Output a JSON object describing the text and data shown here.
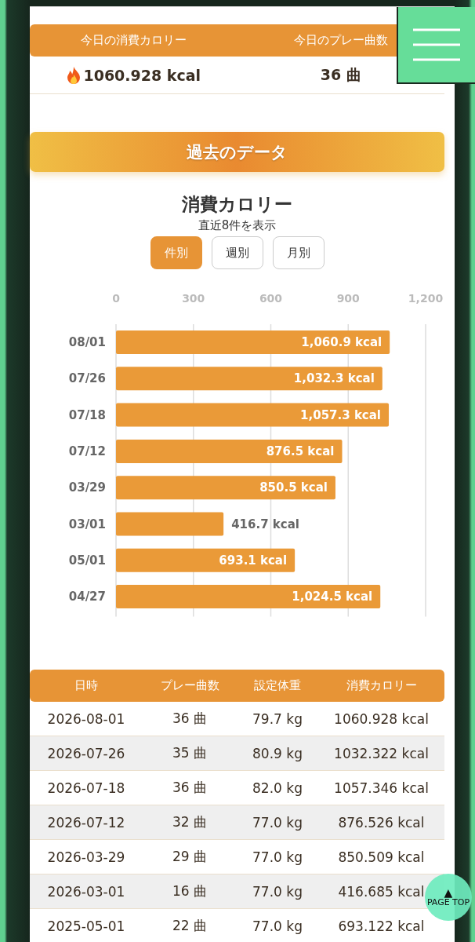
{
  "today_stats": {
    "headers": [
      "今日の消費カロリー",
      "今日のプレー曲数"
    ],
    "calories": "1060.928 kcal",
    "songs": "36 曲"
  },
  "section_title": "過去のデータ",
  "chart_section": {
    "subtitle": "直近8件を表示",
    "tabs": [
      {
        "label": "件別",
        "selected": true
      },
      {
        "label": "週別",
        "selected": false
      },
      {
        "label": "月別",
        "selected": false
      }
    ],
    "chart_data": {
      "type": "bar",
      "title": "消費カロリー",
      "orientation": "horizontal",
      "grid": true,
      "categories": [
        "08/01",
        "07/26",
        "07/18",
        "07/12",
        "03/29",
        "03/01",
        "05/01",
        "04/27"
      ],
      "series": [
        {
          "color": "#ea9a38",
          "values": [
            1060.9,
            1032.3,
            1057.3,
            876.5,
            850.5,
            416.7,
            693.1,
            1024.5
          ]
        }
      ],
      "xlim": [
        0,
        1200
      ],
      "xticks": [
        0,
        300,
        600,
        900,
        {
          "value": 1200,
          "label": "1,200"
        }
      ],
      "value_labels": [
        "1,060.9 kcal",
        "1,032.3 kcal",
        "1,057.3 kcal",
        "876.5 kcal",
        "850.5 kcal",
        "416.7 kcal",
        "693.1 kcal",
        "1,024.5 kcal"
      ]
    }
  },
  "table": {
    "columns": [
      "日時",
      "プレー曲数",
      "設定体重",
      "消費カロリー"
    ],
    "rows": [
      [
        "2026-08-01",
        "36 曲",
        "79.7 kg",
        "1060.928 kcal"
      ],
      [
        "2026-07-26",
        "35 曲",
        "80.9 kg",
        "1032.322 kcal"
      ],
      [
        "2026-07-18",
        "36 曲",
        "82.0 kg",
        "1057.346 kcal"
      ],
      [
        "2026-07-12",
        "32 曲",
        "77.0 kg",
        "876.526 kcal"
      ],
      [
        "2026-03-29",
        "29 曲",
        "77.0 kg",
        "850.509 kcal"
      ],
      [
        "2026-03-01",
        "16 曲",
        "77.0 kg",
        "416.685 kcal"
      ],
      [
        "2025-05-01",
        "22 曲",
        "77.0 kg",
        "693.122 kcal"
      ]
    ]
  },
  "page_top_button": {
    "arrow": "▲",
    "label": "PAGE TOP"
  }
}
